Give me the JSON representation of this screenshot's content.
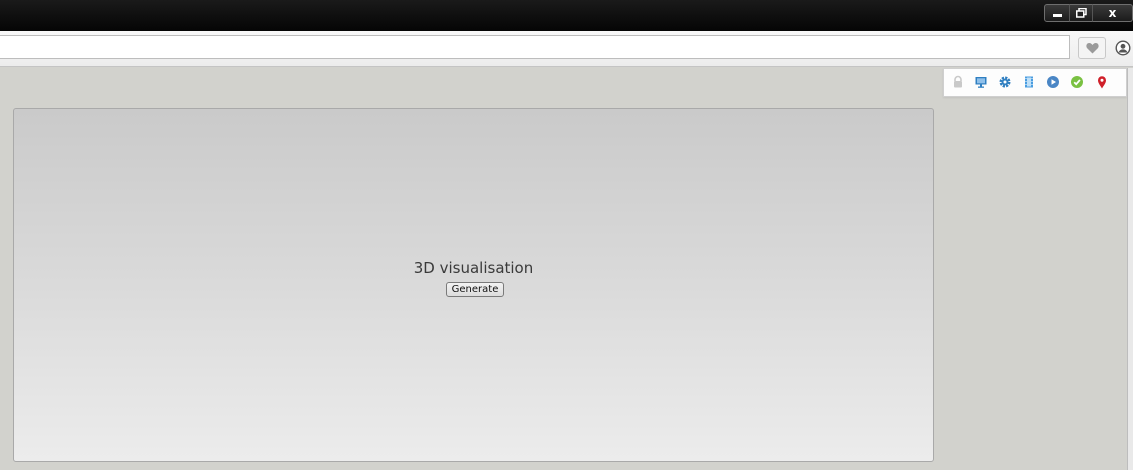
{
  "window": {
    "controls": {
      "minimize_icon": "minimize-icon",
      "maximize_icon": "maximize-icon",
      "close_glyph": "x"
    }
  },
  "toolbar": {
    "url_value": "",
    "heart_icon": "heart-icon",
    "account_icon": "account-icon"
  },
  "extensions": [
    {
      "name": "lock-icon",
      "color": "#c9c9c9"
    },
    {
      "name": "monitor-icon",
      "color": "#2f7fc1"
    },
    {
      "name": "gear-icon",
      "color": "#2f7fc1"
    },
    {
      "name": "film-icon",
      "color": "#4a9de0"
    },
    {
      "name": "play-icon",
      "color": "#4a86c5"
    },
    {
      "name": "shield-check-icon",
      "color": "#7ac142"
    },
    {
      "name": "map-pin-icon",
      "color": "#d0202a"
    }
  ],
  "viz": {
    "title": "3D visualisation",
    "generate_label": "Generate"
  }
}
